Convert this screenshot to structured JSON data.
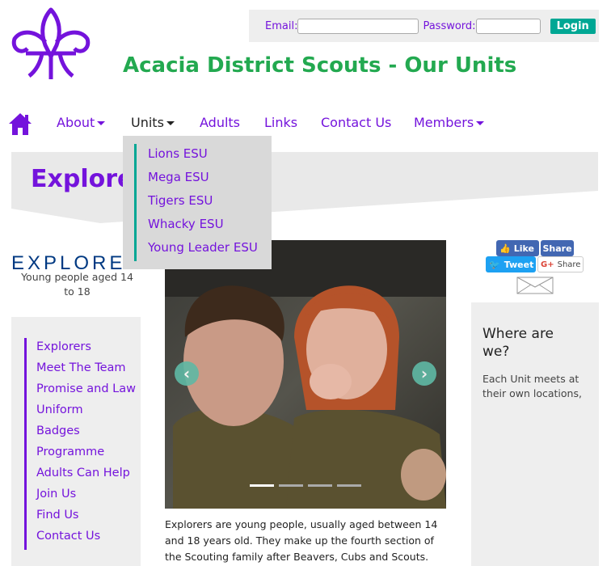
{
  "login": {
    "email_label": "Email:",
    "password_label": "Password:",
    "login_button": "Login"
  },
  "site_title": "Acacia District Scouts - Our Units",
  "nav": {
    "items": [
      {
        "label": "About",
        "dropdown": true
      },
      {
        "label": "Units",
        "dropdown": true,
        "active": true
      },
      {
        "label": "Adults",
        "dropdown": false
      },
      {
        "label": "Links",
        "dropdown": false
      },
      {
        "label": "Contact Us",
        "dropdown": false
      },
      {
        "label": "Members",
        "dropdown": true
      }
    ]
  },
  "units_dropdown": [
    "Lions ESU",
    "Mega ESU",
    "Tigers ESU",
    "Whacky ESU",
    "Young Leader ESU"
  ],
  "banner_title": "Explorers",
  "section_logo": "EXPLORERS",
  "section_subtitle": "Young people aged 14 to 18",
  "side_menu": [
    "Explorers",
    "Meet The Team",
    "Promise and Law",
    "Uniform",
    "Badges",
    "Programme",
    "Adults Can Help",
    "Join Us",
    "Find Us",
    "Contact Us"
  ],
  "carousel": {
    "slide_count": 4,
    "active_slide": 1
  },
  "intro_text": "Explorers are young people, usually aged between 14 and 18 years old. They make up the fourth section of the Scouting family after Beavers, Cubs and Scouts.",
  "share": {
    "like": "Like",
    "share": "Share",
    "tweet": "Tweet",
    "gshare": "Share"
  },
  "where": {
    "title": "Where are we?",
    "text": "Each Unit meets at their own locations,"
  },
  "colors": {
    "brand_purple": "#7413dc",
    "teal": "#00a794",
    "green_title": "#23a950"
  }
}
